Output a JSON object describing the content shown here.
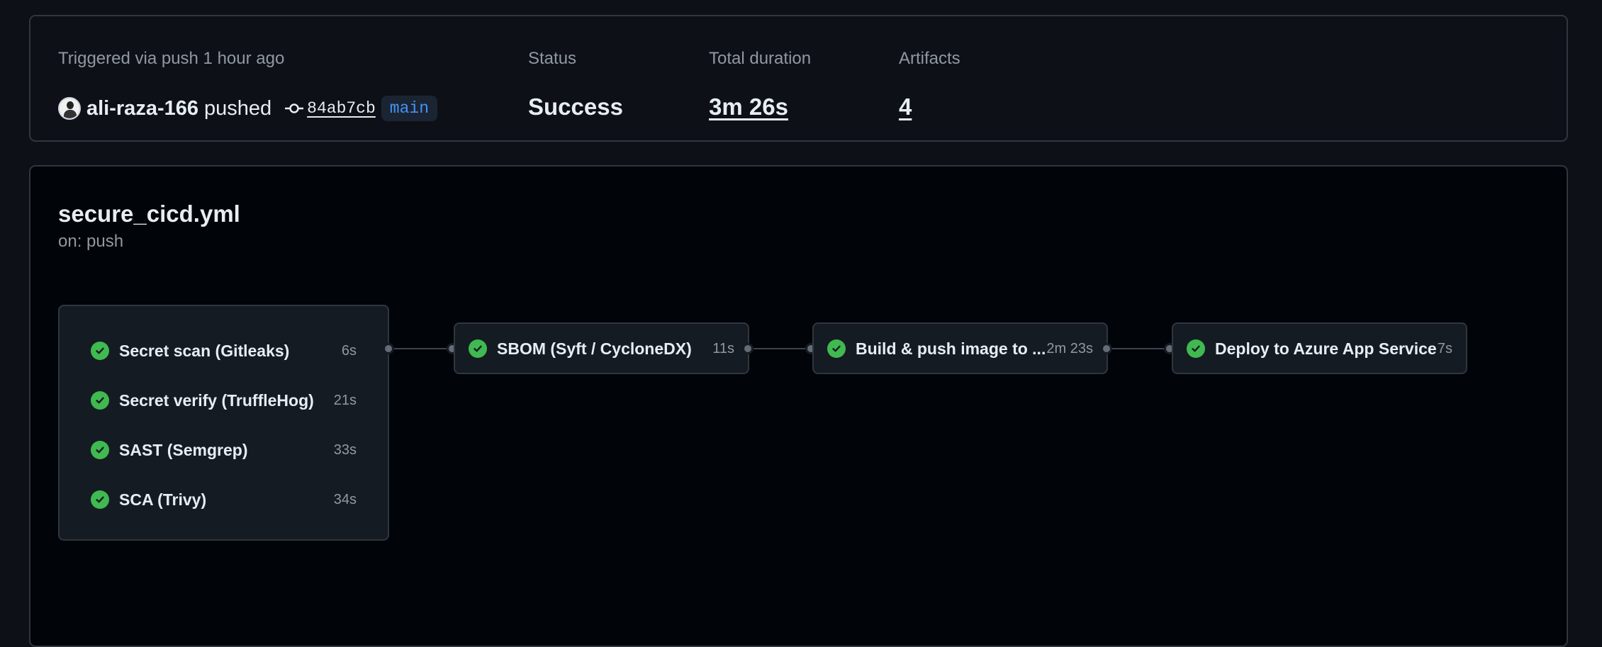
{
  "summary": {
    "trigger_label": "Triggered via push 1 hour ago",
    "actor": "ali-raza-166",
    "action": "pushed",
    "commit_sha": "84ab7cb",
    "branch": "main",
    "status_label": "Status",
    "status_value": "Success",
    "duration_label": "Total duration",
    "duration_value": "3m 26s",
    "artifacts_label": "Artifacts",
    "artifacts_value": "4"
  },
  "workflow": {
    "name": "secure_cicd.yml",
    "trigger": "on: push",
    "group_jobs": [
      {
        "name": "Secret scan (Gitleaks)",
        "duration": "6s",
        "status": "success"
      },
      {
        "name": "Secret verify (TruffleHog)",
        "duration": "21s",
        "status": "success"
      },
      {
        "name": "SAST (Semgrep)",
        "duration": "33s",
        "status": "success"
      },
      {
        "name": "SCA (Trivy)",
        "duration": "34s",
        "status": "success"
      }
    ],
    "stage_jobs": [
      {
        "name": "SBOM (Syft / CycloneDX)",
        "duration": "11s",
        "status": "success"
      },
      {
        "name": "Build & push image to ...",
        "duration": "2m 23s",
        "status": "success"
      },
      {
        "name": "Deploy to Azure App Service",
        "duration": "7s",
        "status": "success"
      }
    ]
  },
  "colors": {
    "success": "#3fb950",
    "branch_text": "#4493f8",
    "card_border": "#30363d"
  },
  "icons": {
    "commit": "git-commit-icon",
    "job_status": "check-circle-icon"
  }
}
